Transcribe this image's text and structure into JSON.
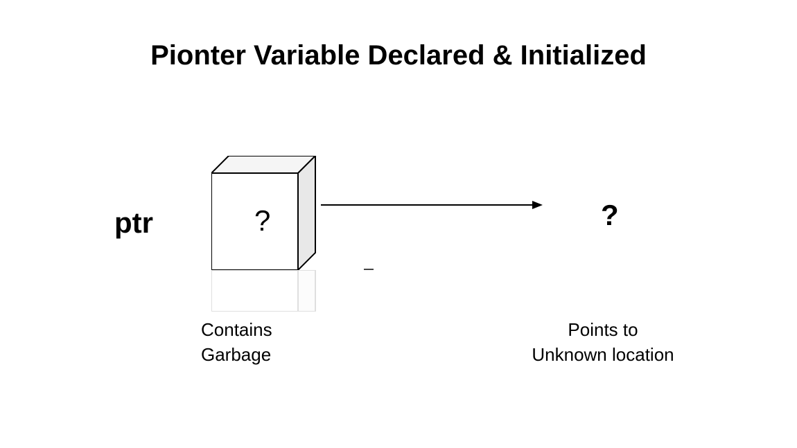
{
  "title": "Pionter Variable Declared & Initialized",
  "ptr_label": "ptr",
  "box_content": "?",
  "destination_content": "?",
  "caption_left_line1": "Contains",
  "caption_left_line2": "Garbage",
  "caption_right_line1": "Points to",
  "caption_right_line2": "Unknown location"
}
